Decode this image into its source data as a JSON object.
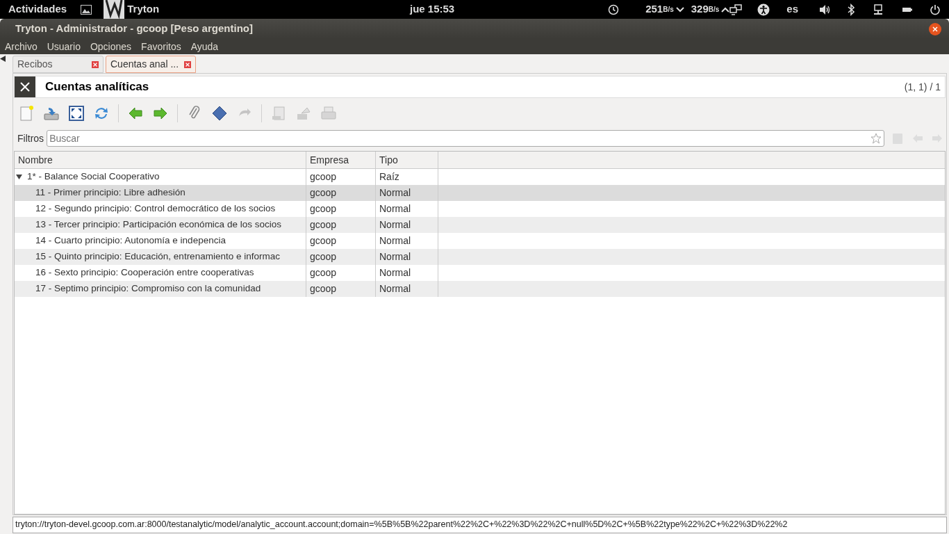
{
  "top_bar": {
    "activities": "Actividades",
    "app_name": "Tryton",
    "clock": "jue 15:53",
    "net_down": "251",
    "net_down_unit": "B/s",
    "net_up": "329",
    "net_up_unit": "B/s",
    "language": "es"
  },
  "window": {
    "title": "Tryton - Administrador - gcoop [Peso argentino]"
  },
  "menu": [
    "Archivo",
    "Usuario",
    "Opciones",
    "Favoritos",
    "Ayuda"
  ],
  "tabs": [
    {
      "label": "Recibos",
      "selected": false
    },
    {
      "label": "Cuentas anal ...",
      "selected": true
    }
  ],
  "form": {
    "title": "Cuentas analíticas",
    "record_count": "(1, 1) / 1"
  },
  "toolbar": [
    {
      "kind": "new",
      "disabled": false
    },
    {
      "kind": "save",
      "disabled": false
    },
    {
      "kind": "switch",
      "disabled": false
    },
    {
      "kind": "reload",
      "disabled": false
    },
    {
      "kind": "sep"
    },
    {
      "kind": "previous",
      "disabled": false
    },
    {
      "kind": "next",
      "disabled": false
    },
    {
      "kind": "sep"
    },
    {
      "kind": "attach",
      "disabled": false
    },
    {
      "kind": "action",
      "disabled": false
    },
    {
      "kind": "relate",
      "disabled": true
    },
    {
      "kind": "sep"
    },
    {
      "kind": "report",
      "disabled": true
    },
    {
      "kind": "email",
      "disabled": true
    },
    {
      "kind": "print",
      "disabled": true
    }
  ],
  "filter": {
    "label": "Filtros",
    "placeholder": "Buscar"
  },
  "table": {
    "columns": [
      "Nombre",
      "Empresa",
      "Tipo"
    ],
    "rows": [
      {
        "name": "1* - Balance Social Cooperativo",
        "company": "gcoop",
        "type": "Raíz",
        "selected": false,
        "expanded": true,
        "children": [
          {
            "name": "11 - Primer principio: Libre adhesión",
            "company": "gcoop",
            "type": "Normal",
            "selected": true
          },
          {
            "name": "12 - Segundo principio: Control democrático de los socios",
            "company": "gcoop",
            "type": "Normal",
            "selected": false
          },
          {
            "name": "13 - Tercer principio: Participación económica de los socios",
            "company": "gcoop",
            "type": "Normal",
            "selected": false
          },
          {
            "name": "14 - Cuarto principio: Autonomía e indepencia",
            "company": "gcoop",
            "type": "Normal",
            "selected": false
          },
          {
            "name": "15 - Quinto principio: Educación, entrenamiento e informac",
            "company": "gcoop",
            "type": "Normal",
            "selected": false
          },
          {
            "name": "16 - Sexto principio: Cooperación entre cooperativas",
            "company": "gcoop",
            "type": "Normal",
            "selected": false
          },
          {
            "name": "17 - Septimo principio: Compromiso con la comunidad",
            "company": "gcoop",
            "type": "Normal",
            "selected": false
          }
        ]
      }
    ]
  },
  "status_bar": "tryton://tryton-devel.gcoop.com.ar:8000/testanalytic/model/analytic_account.account;domain=%5B%5B%22parent%22%2C+%22%3D%22%2C+null%5D%2C+%5B%22type%22%2C+%22%3D%22%2"
}
